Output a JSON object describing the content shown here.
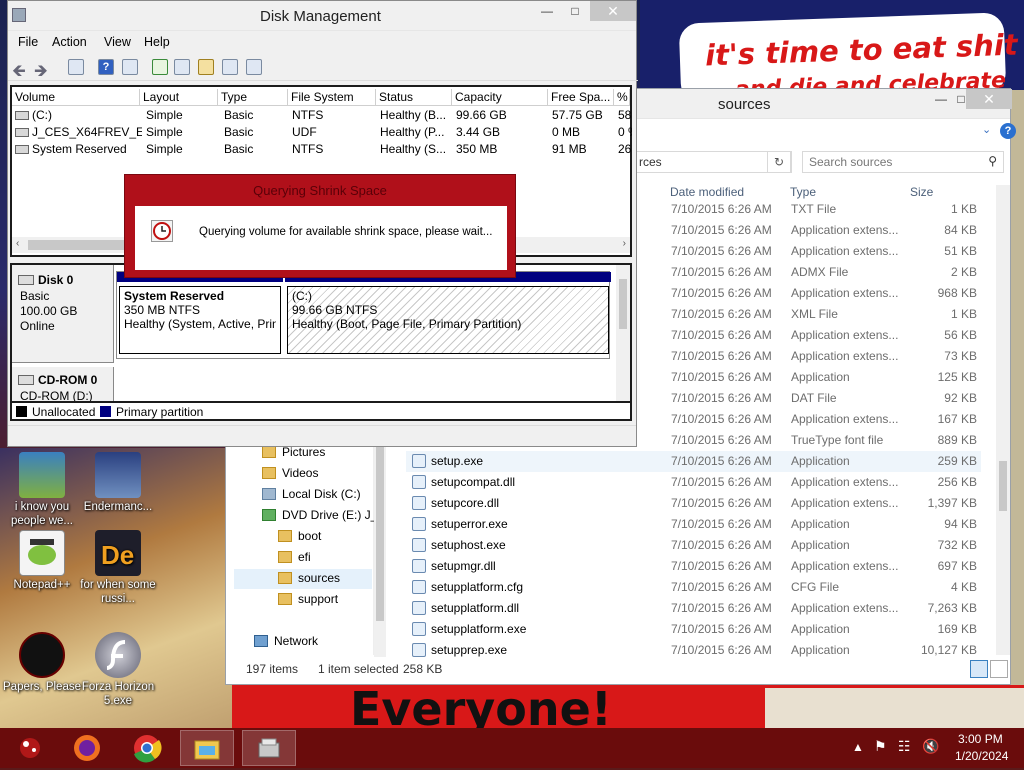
{
  "wallpaper": {
    "sign_line1": "it's time to eat shit",
    "sign_line2": "and die and celebrate",
    "banner": "Everyone!"
  },
  "desktop_icons": [
    {
      "label": "i know you people we..."
    },
    {
      "label": "Endermanc..."
    },
    {
      "label": "Notepad++"
    },
    {
      "label": "for when some russi..."
    },
    {
      "label": "Papers, Please"
    },
    {
      "label": "Forza Horizon 5.exe"
    }
  ],
  "explorer": {
    "title": "sources",
    "address_tail": "rces",
    "search_placeholder": "Search sources",
    "columns": {
      "date": "Date modified",
      "type": "Type",
      "size": "Size"
    },
    "files": [
      {
        "name": "",
        "date": "7/10/2015 6:26 AM",
        "type": "TXT File",
        "size": "1 KB"
      },
      {
        "name": "",
        "date": "7/10/2015 6:26 AM",
        "type": "Application extens...",
        "size": "84 KB"
      },
      {
        "name": "",
        "date": "7/10/2015 6:26 AM",
        "type": "Application extens...",
        "size": "51 KB"
      },
      {
        "name": "",
        "date": "7/10/2015 6:26 AM",
        "type": "ADMX File",
        "size": "2 KB"
      },
      {
        "name": "",
        "date": "7/10/2015 6:26 AM",
        "type": "Application extens...",
        "size": "968 KB"
      },
      {
        "name": "",
        "date": "7/10/2015 6:26 AM",
        "type": "XML File",
        "size": "1 KB"
      },
      {
        "name": "",
        "date": "7/10/2015 6:26 AM",
        "type": "Application extens...",
        "size": "56 KB"
      },
      {
        "name": "",
        "date": "7/10/2015 6:26 AM",
        "type": "Application extens...",
        "size": "73 KB"
      },
      {
        "name": "",
        "date": "7/10/2015 6:26 AM",
        "type": "Application",
        "size": "125 KB"
      },
      {
        "name": "",
        "date": "7/10/2015 6:26 AM",
        "type": "DAT File",
        "size": "92 KB"
      },
      {
        "name": "",
        "date": "7/10/2015 6:26 AM",
        "type": "Application extens...",
        "size": "167 KB"
      },
      {
        "name": "",
        "date": "7/10/2015 6:26 AM",
        "type": "TrueType font file",
        "size": "889 KB"
      },
      {
        "name": "setup.exe",
        "date": "7/10/2015 6:26 AM",
        "type": "Application",
        "size": "259 KB"
      },
      {
        "name": "setupcompat.dll",
        "date": "7/10/2015 6:26 AM",
        "type": "Application extens...",
        "size": "256 KB"
      },
      {
        "name": "setupcore.dll",
        "date": "7/10/2015 6:26 AM",
        "type": "Application extens...",
        "size": "1,397 KB"
      },
      {
        "name": "setuperror.exe",
        "date": "7/10/2015 6:26 AM",
        "type": "Application",
        "size": "94 KB"
      },
      {
        "name": "setuphost.exe",
        "date": "7/10/2015 6:26 AM",
        "type": "Application",
        "size": "732 KB"
      },
      {
        "name": "setupmgr.dll",
        "date": "7/10/2015 6:26 AM",
        "type": "Application extens...",
        "size": "697 KB"
      },
      {
        "name": "setupplatform.cfg",
        "date": "7/10/2015 6:26 AM",
        "type": "CFG File",
        "size": "4 KB"
      },
      {
        "name": "setupplatform.dll",
        "date": "7/10/2015 6:26 AM",
        "type": "Application extens...",
        "size": "7,263 KB"
      },
      {
        "name": "setupplatform.exe",
        "date": "7/10/2015 6:26 AM",
        "type": "Application",
        "size": "169 KB"
      },
      {
        "name": "setupprep.exe",
        "date": "7/10/2015 6:26 AM",
        "type": "Application",
        "size": "10,127 KB"
      }
    ],
    "nav": [
      {
        "label": "Pictures"
      },
      {
        "label": "Videos"
      },
      {
        "label": "Local Disk (C:)"
      },
      {
        "label": "DVD Drive (E:) J_C"
      },
      {
        "label": "boot"
      },
      {
        "label": "efi"
      },
      {
        "label": "sources"
      },
      {
        "label": "support"
      },
      {
        "label": "Network"
      }
    ],
    "status": {
      "items": "197 items",
      "selected": "1 item selected",
      "size": "258 KB"
    }
  },
  "diskmgmt": {
    "title": "Disk Management",
    "menu": [
      "File",
      "Action",
      "View",
      "Help"
    ],
    "columns": [
      "Volume",
      "Layout",
      "Type",
      "File System",
      "Status",
      "Capacity",
      "Free Spa...",
      "% F"
    ],
    "volumes": [
      {
        "volume": "(C:)",
        "layout": "Simple",
        "type": "Basic",
        "fs": "NTFS",
        "status": "Healthy (B...",
        "capacity": "99.66 GB",
        "free": "57.75 GB",
        "pct": "58"
      },
      {
        "volume": "J_CES_X64FREV_E...",
        "layout": "Simple",
        "type": "Basic",
        "fs": "UDF",
        "status": "Healthy (P...",
        "capacity": "3.44 GB",
        "free": "0 MB",
        "pct": "0 %"
      },
      {
        "volume": "System Reserved",
        "layout": "Simple",
        "type": "Basic",
        "fs": "NTFS",
        "status": "Healthy (S...",
        "capacity": "350 MB",
        "free": "91 MB",
        "pct": "26"
      }
    ],
    "disk0": {
      "name": "Disk 0",
      "type": "Basic",
      "size": "100.00 GB",
      "state": "Online"
    },
    "cdrom0": {
      "name": "CD-ROM 0",
      "sub": "CD-ROM (D:)"
    },
    "partitions": [
      {
        "name": "System Reserved",
        "size": "350 MB NTFS",
        "status": "Healthy (System, Active, Prin"
      },
      {
        "name": "(C:)",
        "size": "99.66 GB NTFS",
        "status": "Healthy (Boot, Page File, Primary Partition)"
      }
    ],
    "legend": {
      "unallocated": "Unallocated",
      "primary": "Primary partition"
    }
  },
  "dialog": {
    "title": "Querying Shrink Space",
    "message": "Querying volume for available shrink space, please wait..."
  },
  "taskbar": {
    "time": "3:00 PM",
    "date": "1/20/2024"
  },
  "colors": {
    "dialog": "#b0101a",
    "taskbar": "#6a0c0c",
    "primary_partition": "#000080"
  }
}
